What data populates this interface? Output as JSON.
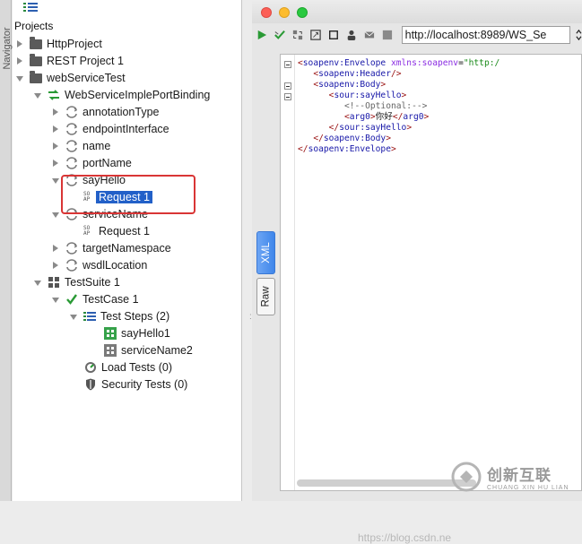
{
  "navigator": {
    "label": "Navigator"
  },
  "tree": {
    "title": "Projects",
    "rows": [
      {
        "label": "HttpProject"
      },
      {
        "label": "REST Project 1"
      },
      {
        "label": "webServiceTest"
      },
      {
        "label": "WebServiceImplePortBinding"
      },
      {
        "label": "annotationType"
      },
      {
        "label": "endpointInterface"
      },
      {
        "label": "name"
      },
      {
        "label": "portName"
      },
      {
        "label": "sayHello"
      },
      {
        "label": "Request 1",
        "selected": true
      },
      {
        "label": "serviceName"
      },
      {
        "label": "Request 1"
      },
      {
        "label": "targetNamespace"
      },
      {
        "label": "wsdlLocation"
      },
      {
        "label": "TestSuite 1"
      },
      {
        "label": "TestCase 1"
      },
      {
        "label": "Test Steps (2)"
      },
      {
        "label": "sayHello1"
      },
      {
        "label": "serviceName2"
      },
      {
        "label": "Load Tests (0)"
      },
      {
        "label": "Security Tests (0)"
      }
    ],
    "soap_badge": [
      "SO",
      "AP"
    ]
  },
  "editor": {
    "url": "http://localhost:8989/WS_Se",
    "tabs": {
      "xml": "XML",
      "raw": "Raw"
    },
    "code": {
      "l1_tag": "soapenv:Envelope",
      "l1_attr": "xmlns:soapenv",
      "l1_val": "\"http:/",
      "l2_tag": "soapenv:Header",
      "l3_tag": "soapenv:Body",
      "l4_tag": "sour:sayHello",
      "l5_comment": "<!--Optional:-->",
      "l6_tag": "arg0",
      "l6_text": "你好",
      "l7_tag": "sour:sayHello",
      "l8_tag": "soapenv:Body",
      "l9_tag": "soapenv:Envelope"
    },
    "watermark": "https://blog.csdn.ne",
    "brand": {
      "name": "创新互联",
      "sub": "CHUANG XIN HU LIAN"
    }
  },
  "colors": {
    "selection": "#2260c8",
    "highlight_box": "#d93535",
    "xml_tab": "#3f86ea"
  }
}
